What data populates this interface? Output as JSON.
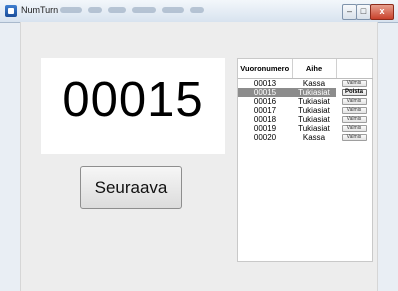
{
  "window": {
    "title": "NumTurn",
    "controls": {
      "minimize": "–",
      "maximize": "□",
      "close": "x"
    }
  },
  "display": {
    "current_number": "00015"
  },
  "next_button": {
    "label": "Seuraava"
  },
  "queue": {
    "columns": [
      "Vuoronumero",
      "Aihe",
      ""
    ],
    "rows": [
      {
        "number": "00013",
        "topic": "Kassa",
        "action": "Valmis"
      },
      {
        "number": "00015",
        "topic": "Tukiasiat",
        "action": "Poista",
        "selected": true
      },
      {
        "number": "00016",
        "topic": "Tukiasiat",
        "action": "Valmis"
      },
      {
        "number": "00017",
        "topic": "Tukiasiat",
        "action": "Valmis"
      },
      {
        "number": "00018",
        "topic": "Tukiasiat",
        "action": "Valmis"
      },
      {
        "number": "00019",
        "topic": "Tukiasiat",
        "action": "Valmis"
      },
      {
        "number": "00020",
        "topic": "Kassa",
        "action": "Valmis"
      }
    ]
  }
}
